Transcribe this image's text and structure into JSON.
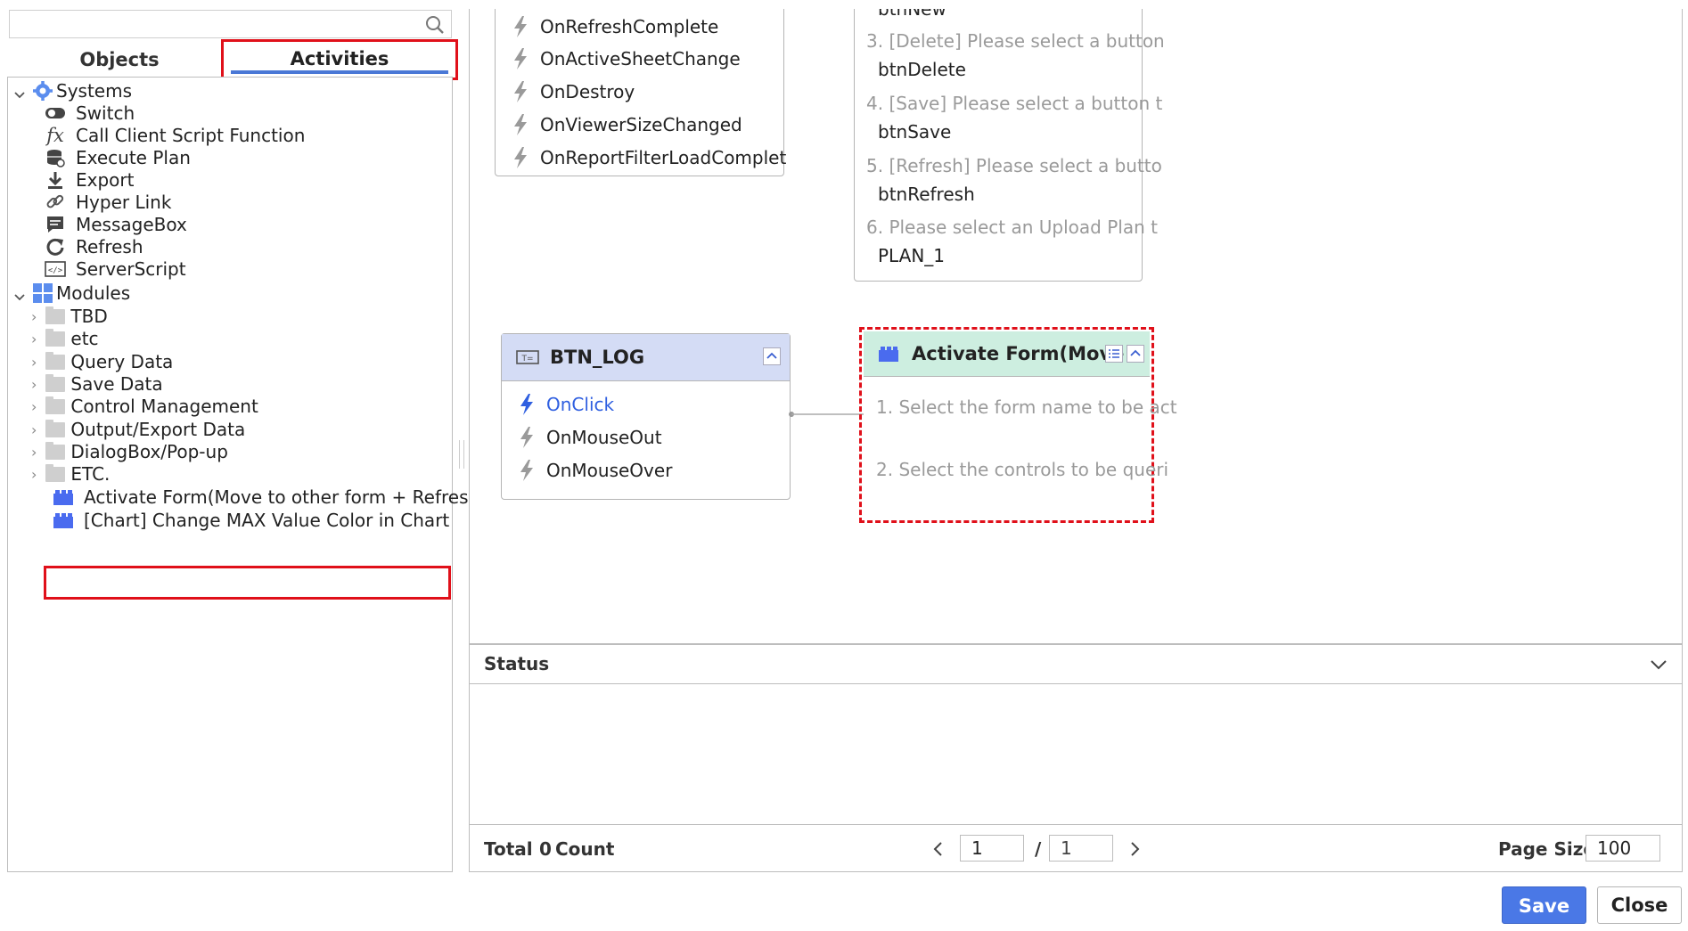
{
  "left": {
    "tabs": {
      "objects": "Objects",
      "activities": "Activities"
    },
    "tree": {
      "systems": {
        "label": "Systems",
        "items": [
          "Switch",
          "Call Client Script Function",
          "Execute Plan",
          "Export",
          "Hyper Link",
          "MessageBox",
          "Refresh",
          "ServerScript"
        ]
      },
      "modules": {
        "label": "Modules",
        "folders": [
          "TBD",
          "etc",
          "Query Data",
          "Save Data",
          "Control Management",
          "Output/Export Data",
          "DialogBox/Pop-up",
          "ETC."
        ]
      },
      "activities": [
        "Activate Form(Move to other form + Refresh)",
        "[Chart] Change MAX Value Color in Chart"
      ]
    }
  },
  "canvas": {
    "events_node": {
      "items": [
        "OnRefreshComplete",
        "OnActiveSheetChange",
        "OnDestroy",
        "OnViewerSizeChanged",
        "OnReportFilterLoadComplet"
      ]
    },
    "params_node": {
      "top_clipped": "btnNew",
      "rows": [
        {
          "label": "3. [Delete] Please select a button",
          "value": "btnDelete"
        },
        {
          "label": "4. [Save] Please select a button t",
          "value": "btnSave"
        },
        {
          "label": "5. [Refresh] Please select a butto",
          "value": "btnRefresh"
        },
        {
          "label": "6. Please select an Upload Plan t",
          "value": "PLAN_1"
        }
      ]
    },
    "btn_log": {
      "title": "BTN_LOG",
      "events": [
        "OnClick",
        "OnMouseOut",
        "OnMouseOver"
      ],
      "active_color": "#2f5fe0"
    },
    "activate_node": {
      "title": "Activate Form(Move t",
      "params": [
        "1. Select the form name to be act",
        "2. Select the controls to be queri"
      ],
      "header_color": "#cdeee0"
    }
  },
  "status": {
    "title": "Status"
  },
  "pager": {
    "total_label": "Total",
    "count_value": "0",
    "count_label": "Count",
    "current_page": "1",
    "separator": "/",
    "total_pages": "1",
    "page_size_label": "Page Size",
    "page_size": "100"
  },
  "buttons": {
    "save": "Save",
    "close": "Close"
  },
  "colors": {
    "highlight": "#e0101a",
    "accent": "#4a78e6"
  }
}
